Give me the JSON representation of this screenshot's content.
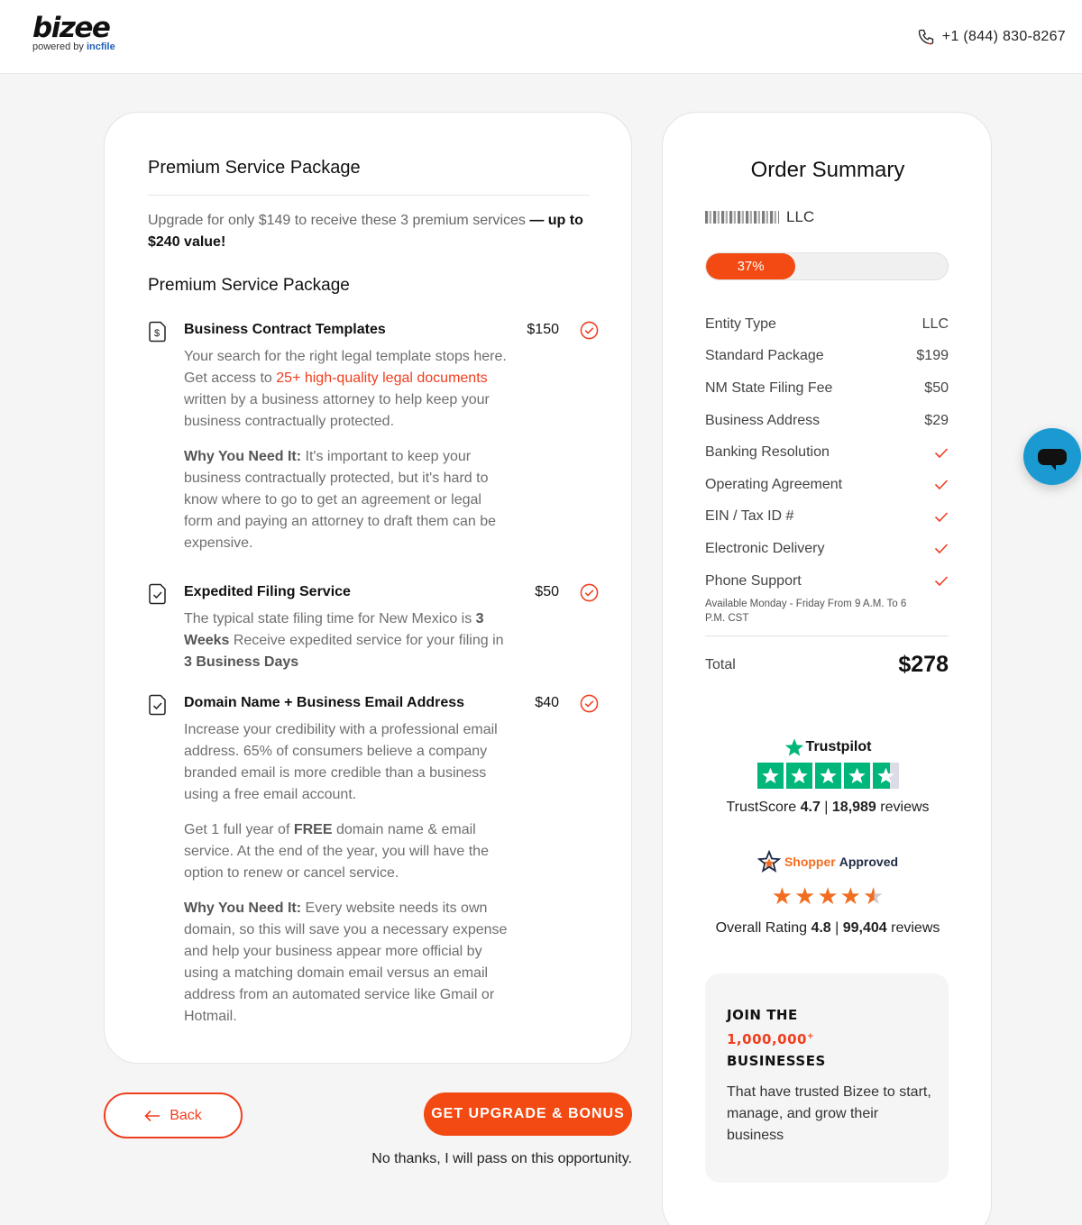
{
  "header": {
    "logo_word": "bizee",
    "logo_powered": "powered by",
    "logo_brand": "incfile",
    "phone": "+1 (844) 830-8267"
  },
  "package": {
    "title": "Premium Service Package",
    "intro_main": "Upgrade for only $149 to receive these 3 premium services",
    "intro_bold": "— up to $240 value!",
    "section_title": "Premium Service Package",
    "services": [
      {
        "name": "Business Contract Templates",
        "price": "$150",
        "icon": "dollar-document-icon",
        "body_1a": "Your search for the right legal template stops here. Get access to ",
        "body_1_link": "25+ high-quality legal documents",
        "body_1b": " written by a business attorney to help keep your business contractually protected.",
        "why_label": "Why You Need It:",
        "why_text": " It's important to keep your business contractually protected, but it's hard to know where to go to get an agreement or legal form and paying an attorney to draft them can be expensive."
      },
      {
        "name": "Expedited Filing Service",
        "price": "$50",
        "icon": "check-document-icon",
        "body_a": "The typical state filing time for New Mexico is ",
        "body_bold1": "3 Weeks",
        "body_b": " Receive expedited service for your filing in ",
        "body_bold2": "3 Business Days"
      },
      {
        "name": "Domain Name + Business Email Address",
        "price": "$40",
        "icon": "check-document-icon",
        "body_1": "Increase your credibility with a professional email address. 65% of consumers believe a company branded email is more credible than a business using a free email account.",
        "body_2a": "Get 1 full year of ",
        "body_2_bold": "FREE",
        "body_2b": " domain name & email service. At the end of the year, you will have the option to renew or cancel service.",
        "why_label": "Why You Need It:",
        "why_text": " Every website needs its own domain, so this will save you a necessary expense and help your business appear more official by using a matching domain email versus an email address from an automated service like Gmail or Hotmail."
      }
    ]
  },
  "actions": {
    "back": "Back",
    "cta": "GET UPGRADE & BONUS",
    "decline": "No thanks, I will pass on this opportunity."
  },
  "summary": {
    "title": "Order Summary",
    "company_suffix": "LLC",
    "progress_label": "37%",
    "progress_value": 0.37,
    "items": [
      {
        "label": "Entity Type",
        "value": "LLC"
      },
      {
        "label": "Standard Package",
        "value": "$199"
      },
      {
        "label": "NM State Filing Fee",
        "value": "$50"
      },
      {
        "label": "Business Address",
        "value": "$29"
      },
      {
        "label": "Banking Resolution",
        "value": "check"
      },
      {
        "label": "Operating Agreement",
        "value": "check"
      },
      {
        "label": "EIN / Tax ID #",
        "value": "check"
      },
      {
        "label": "Electronic Delivery",
        "value": "check"
      },
      {
        "label": "Phone Support",
        "value": "check"
      }
    ],
    "support_note": "Available Monday - Friday From 9 A.M. To 6 P.M. CST",
    "total_label": "Total",
    "total_value": "$278"
  },
  "trustpilot": {
    "brand": "Trustpilot",
    "score_label": "TrustScore",
    "score": "4.7",
    "reviews": "18,989",
    "reviews_label": "reviews"
  },
  "shopper": {
    "brand_a": "Shopper",
    "brand_b": "Approved",
    "rating_label": "Overall Rating",
    "rating": "4.8",
    "reviews": "99,404",
    "reviews_label": "reviews"
  },
  "join": {
    "line1": "JOIN THE",
    "number": "1,000,000",
    "plus": "+",
    "line3": "BUSINESSES",
    "text": "That have trusted Bizee to start, manage, and grow their business"
  },
  "colors": {
    "accent": "#f24a12",
    "red": "#f03e1e",
    "trustpilot_green": "#00b67a",
    "shopper_orange": "#f26d21",
    "chat_blue": "#1b9ad1"
  }
}
